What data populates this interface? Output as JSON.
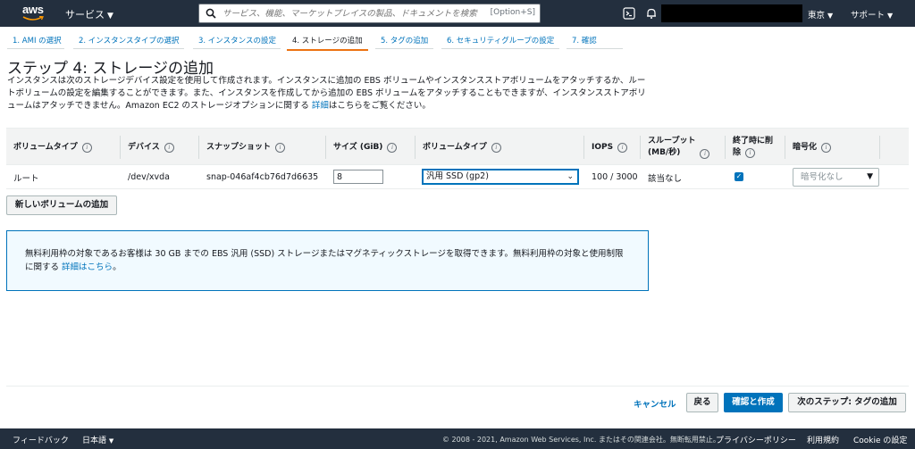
{
  "nav": {
    "logo": "aws",
    "services": "サービス",
    "search_placeholder": "サービス、機能、マーケットプレイスの製品、ドキュメントを検索",
    "search_shortcut": "[Option+S]",
    "region": "東京",
    "support": "サポート"
  },
  "wizard": {
    "tabs": [
      {
        "label": "1. AMI の選択"
      },
      {
        "label": "2. インスタンスタイプの選択"
      },
      {
        "label": "3. インスタンスの設定"
      },
      {
        "label": "4. ストレージの追加"
      },
      {
        "label": "5. タグの追加"
      },
      {
        "label": "6. セキュリティグループの設定"
      },
      {
        "label": "7. 確認"
      }
    ]
  },
  "page": {
    "title": "ステップ 4: ストレージの追加",
    "desc_part1": "インスタンスは次のストレージデバイス設定を使用して作成されます。インスタンスに追加の EBS ボリュームやインスタンスストアボリュームをアタッチするか、ルートボリュームの設定を編集することができます。また、インスタンスを作成してから追加の EBS ボリュームをアタッチすることもできますが、インスタンスストアボリュームはアタッチできません。Amazon EC2 のストレージオプションに関する",
    "desc_link": "詳細",
    "desc_part2": "はこちらをご覧ください。"
  },
  "table": {
    "headers": {
      "volume_type": "ボリュームタイプ",
      "device": "デバイス",
      "snapshot": "スナップショット",
      "size": "サイズ (GiB)",
      "ebs_type": "ボリュームタイプ",
      "iops": "IOPS",
      "throughput_l1": "スループット",
      "throughput_l2": "(MB/秒)",
      "delete_l1": "終了時に削",
      "delete_l2": "除",
      "encryption": "暗号化"
    },
    "info_glyph": "i",
    "row": {
      "volume_type": "ルート",
      "device": "/dev/xvda",
      "snapshot": "snap-046af4cb76d7d6635",
      "size": "8",
      "ebs_type": "汎用 SSD (gp2)",
      "iops": "100 / 3000",
      "throughput": "該当なし",
      "delete_on_termination": true,
      "encryption": "暗号化なし"
    }
  },
  "add_volume_button": "新しいボリュームの追加",
  "infobox": {
    "text": "無料利用枠の対象であるお客様は 30 GB までの EBS 汎用 (SSD) ストレージまたはマグネティックストレージを取得できます。無料利用枠の対象と使用制限に関する",
    "link": "詳細はこちら",
    "suffix": "。"
  },
  "actions": {
    "cancel": "キャンセル",
    "back": "戻る",
    "review_launch": "確認と作成",
    "next": "次のステップ: タグの追加"
  },
  "footer": {
    "feedback": "フィードバック",
    "language": "日本語",
    "copyright": "© 2008 - 2021, Amazon Web Services, Inc. またはその関連会社。無断転用禁止。",
    "privacy": "プライバシーポリシー",
    "terms": "利用規約",
    "cookie": "Cookie の設定"
  },
  "colors": {
    "nav_bg": "#232f3e",
    "link": "#0073bb",
    "active_tab": "#ec7211",
    "info_bg": "#f1faff"
  }
}
